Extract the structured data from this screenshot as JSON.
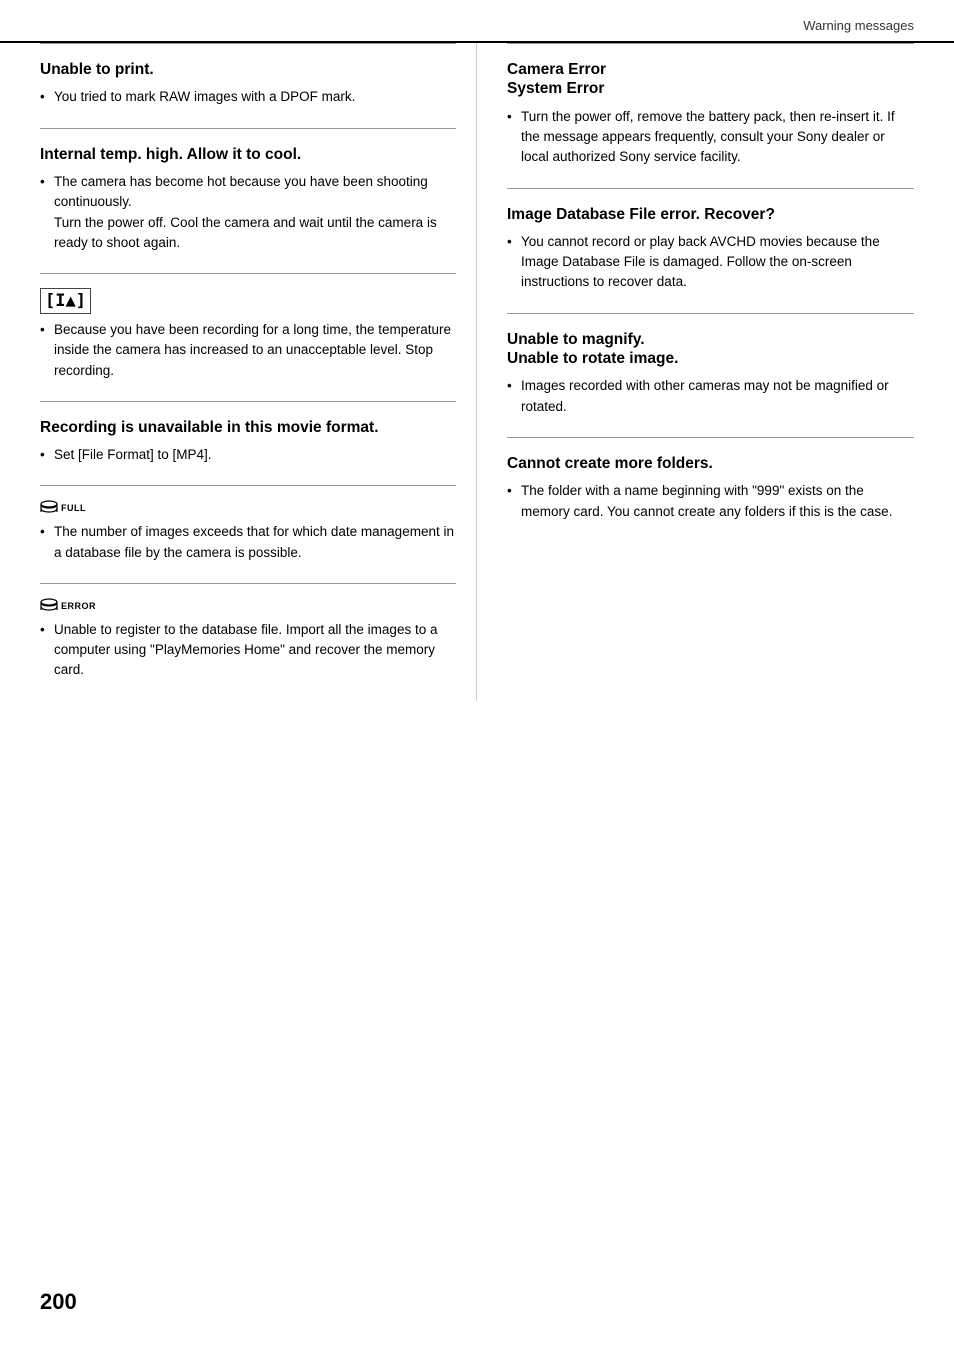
{
  "header": {
    "title": "Warning messages"
  },
  "page_number": "200",
  "left_col": {
    "sections": [
      {
        "id": "unable-to-print",
        "title": "Unable to print.",
        "bullets": [
          "You tried to mark RAW images with a DPOF mark."
        ]
      },
      {
        "id": "internal-temp",
        "title": "Internal temp. high. Allow it to cool.",
        "bullets": [
          "The camera has become hot because you have been shooting continuously.\nTurn the power off. Cool the camera and wait until the camera is ready to shoot again."
        ]
      }
    ],
    "icon_sections": [
      {
        "id": "bracket-icon-section",
        "icon_type": "bracket",
        "icon_display": "[1▲]",
        "bullets": [
          "Because you have been recording for a long time, the temperature inside the camera has increased to an unacceptable level. Stop recording."
        ]
      },
      {
        "id": "recording-unavailable",
        "title": "Recording is unavailable in this movie format.",
        "bullets": [
          "Set [File Format] to [MP4]."
        ]
      },
      {
        "id": "db-full-section",
        "icon_type": "db_full",
        "icon_display": "🗃FULL",
        "bullets": [
          "The number of images exceeds that for which date management in a database file by the camera is possible."
        ]
      },
      {
        "id": "db-error-section",
        "icon_type": "db_error",
        "icon_display": "🗃ERROR",
        "bullets": [
          "Unable to register to the database file. Import all the images to a computer using \"PlayMemories Home\" and recover the memory card."
        ]
      }
    ]
  },
  "right_col": {
    "sections": [
      {
        "id": "camera-error",
        "title": "Camera Error\nSystem Error",
        "bullets": [
          "Turn the power off, remove the battery pack, then re-insert it. If the message appears frequently, consult your Sony dealer or local authorized Sony service facility."
        ]
      },
      {
        "id": "image-database-error",
        "title": "Image Database File error. Recover?",
        "bullets": [
          "You cannot record or play back AVCHD movies because the Image Database File is damaged. Follow the on-screen instructions to recover data."
        ]
      },
      {
        "id": "unable-to-magnify",
        "title": "Unable to magnify.\nUnable to rotate image.",
        "bullets": [
          "Images recorded with other cameras may not be magnified or rotated."
        ]
      },
      {
        "id": "cannot-create-folders",
        "title": "Cannot create more folders.",
        "bullets": [
          "The folder with a name beginning with \"999\" exists on the memory card. You cannot create any folders if this is the case."
        ]
      }
    ]
  }
}
